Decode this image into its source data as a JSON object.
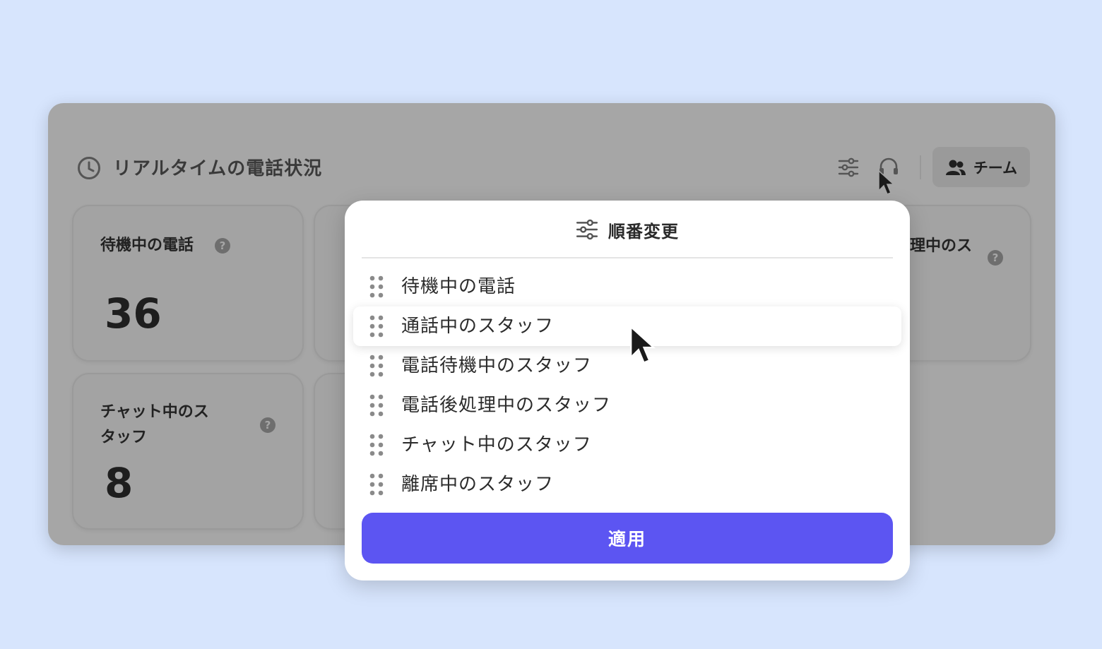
{
  "header": {
    "title": "リアルタイムの電話状況",
    "team_label": "チーム",
    "icons": [
      "clock-icon",
      "sliders-icon",
      "headset-icon",
      "users-icon"
    ]
  },
  "cards": [
    {
      "title": "待機中の電話",
      "value": "36"
    },
    {
      "title": "チャット中のス\nタッフ",
      "value": "8"
    }
  ],
  "partial_text": {
    "right_card_title": "理中のス"
  },
  "modal": {
    "title": "順番変更",
    "items": [
      {
        "label": "待機中の電話"
      },
      {
        "label": "通話中のスタッフ"
      },
      {
        "label": "電話待機中のスタッフ"
      },
      {
        "label": "電話後処理中のスタッフ"
      },
      {
        "label": "チャット中のスタッフ"
      },
      {
        "label": "離席中のスタッフ"
      }
    ],
    "apply_label": "適用",
    "highlighted_index": 1
  },
  "colors": {
    "page_bg": "#d7e5fd",
    "overlay_panel": "#a6a6a6",
    "accent": "#5c55f2",
    "modal_bg": "#ffffff"
  }
}
